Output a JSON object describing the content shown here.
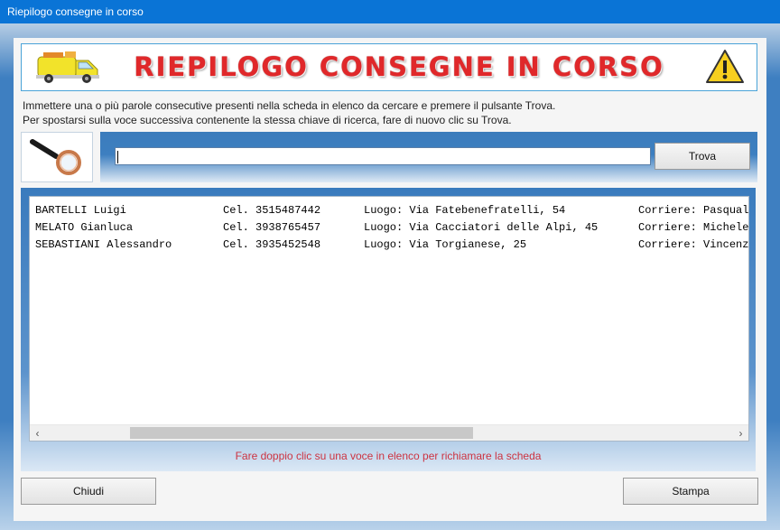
{
  "window": {
    "title": "Riepilogo consegne in corso"
  },
  "banner": {
    "title": "RIEPILOGO CONSEGNE IN CORSO",
    "left_icon": "delivery-van-icon",
    "right_icon": "warning-icon"
  },
  "instructions": {
    "line1": "Immettere una o più parole consecutive presenti nella scheda in elenco da cercare e premere il pulsante Trova.",
    "line2": "Per spostarsi sulla voce successiva contenente la stessa chiave di ricerca, fare di nuovo clic su Trova."
  },
  "search": {
    "icon": "magnifier-icon",
    "value": "",
    "button_label": "Trova"
  },
  "list": {
    "rows": [
      {
        "name": "BARTELLI Luigi",
        "phone": "Cel. 3515487442",
        "place": "Luogo: Via Fatebenefratelli, 54",
        "courier": "Corriere: Pasqual"
      },
      {
        "name": "MELATO Gianluca",
        "phone": "Cel. 3938765457",
        "place": "Luogo: Via Cacciatori delle Alpi, 45",
        "courier": "Corriere: Michele"
      },
      {
        "name": "SEBASTIANI Alessandro",
        "phone": "Cel. 3935452548",
        "place": "Luogo: Via Torgianese, 25",
        "courier": "Corriere: Vincenz"
      }
    ],
    "scroll_left": "‹",
    "scroll_right": "›"
  },
  "hint": "Fare doppio clic su una voce in elenco per richiamare la scheda",
  "footer": {
    "close_label": "Chiudi",
    "print_label": "Stampa"
  },
  "colors": {
    "titlebar": "#0a74d6",
    "banner_text": "#e0282a",
    "hint": "#cc3341"
  }
}
